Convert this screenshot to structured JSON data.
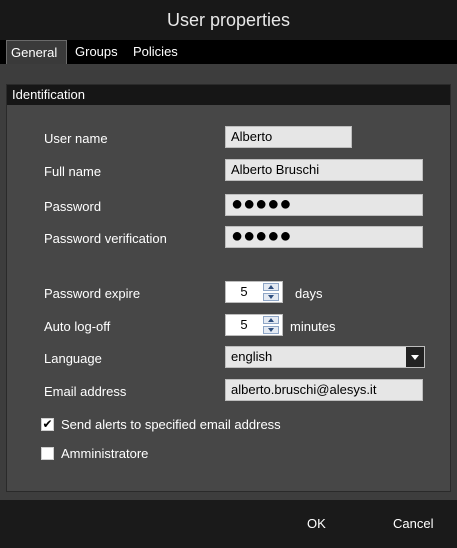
{
  "window": {
    "title": "User properties"
  },
  "tabs": [
    {
      "label": "General",
      "active": true
    },
    {
      "label": "Groups",
      "active": false
    },
    {
      "label": "Policies",
      "active": false
    }
  ],
  "identification": {
    "header": "Identification",
    "user_name": {
      "label": "User name",
      "value": "Alberto"
    },
    "full_name": {
      "label": "Full name",
      "value": "Alberto Bruschi"
    },
    "password": {
      "label": "Password",
      "value": "●●●●●"
    },
    "password_verification": {
      "label": "Password verification",
      "value": "●●●●●"
    },
    "password_expire": {
      "label": "Password expire",
      "value": "5",
      "unit": "days"
    },
    "auto_logoff": {
      "label": "Auto log-off",
      "value": "5",
      "unit": "minutes"
    },
    "language": {
      "label": "Language",
      "value": "english"
    },
    "email": {
      "label": "Email address",
      "value": "alberto.bruschi@alesys.it"
    },
    "send_alerts": {
      "label": "Send alerts to specified email address",
      "checked": true,
      "mark": "✔"
    },
    "administrator": {
      "label": "Amministratore",
      "checked": false,
      "mark": ""
    }
  },
  "footer": {
    "ok_label": "OK",
    "cancel_label": "Cancel"
  },
  "colors": {
    "titlebar": "#181818",
    "panel": "#474747",
    "field_bg": "#e6e6e6",
    "text": "#ffffff"
  }
}
